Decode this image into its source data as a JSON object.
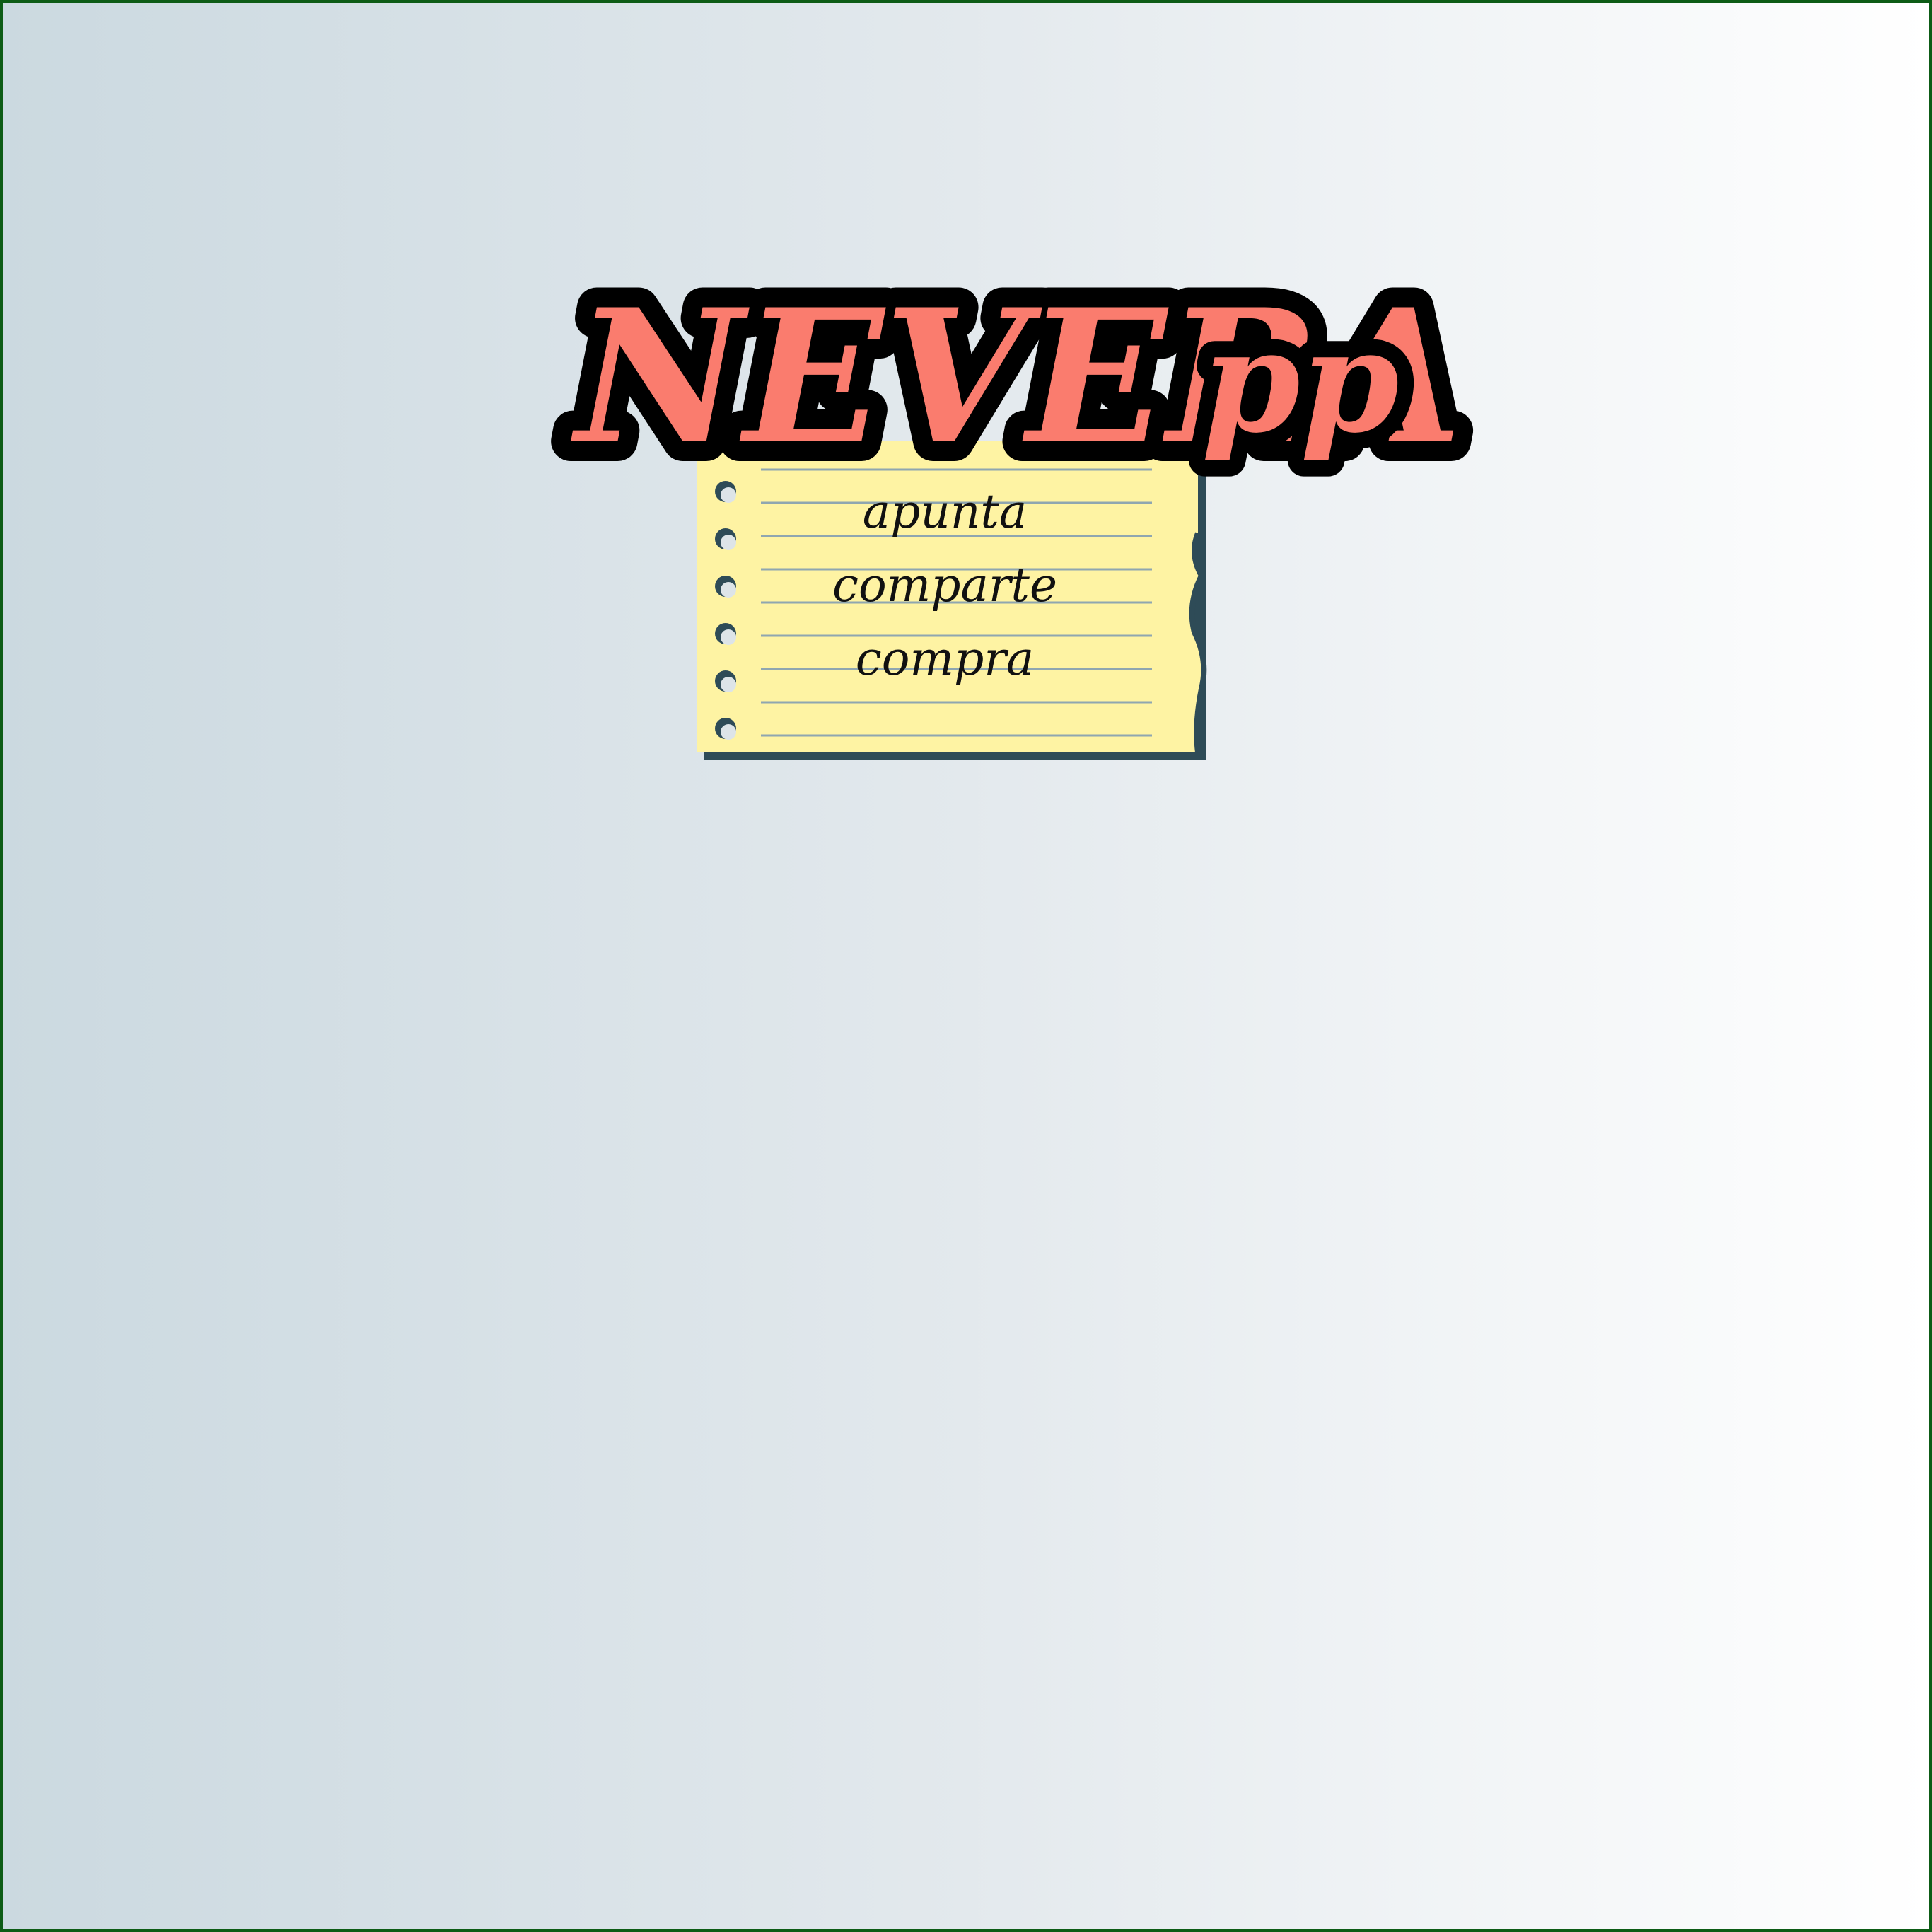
{
  "logo": {
    "title_main": "NEVERA",
    "title_suffix": "pp",
    "colors": {
      "title_fill": "#fa7c6e",
      "title_outline": "#000000",
      "note_paper": "#fef3a3",
      "note_lines": "#8fa6b0",
      "note_edge": "#2e4b57",
      "border": "#0d5c16"
    }
  },
  "note": {
    "lines": [
      "apunta",
      "comparte",
      "compra"
    ]
  }
}
